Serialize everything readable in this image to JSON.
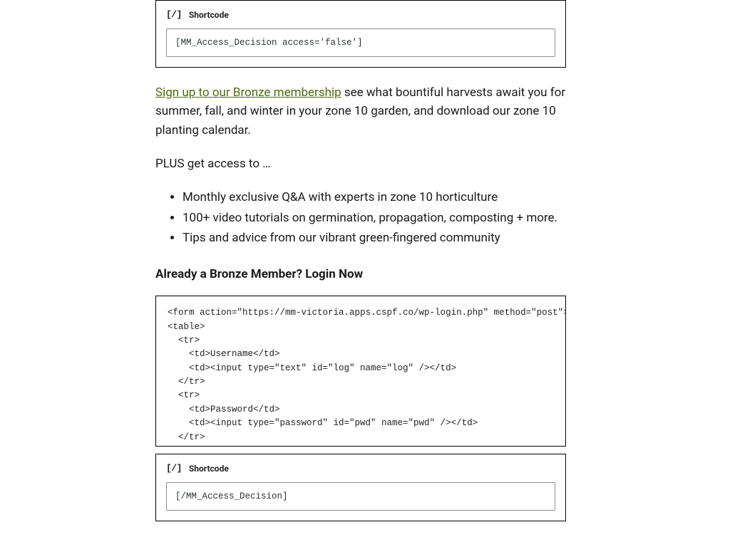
{
  "shortcode_block_1": {
    "icon_text": "[/]",
    "label": "Shortcode",
    "value": "[MM_Access_Decision access='false']"
  },
  "cta": {
    "link_text": "Sign up to our Bronze membership",
    "tail_text": " see what bountiful harvests await you for summer, fall, and winter in your zone 10 garden, and download our zone 10 planting calendar."
  },
  "access_intro": "PLUS get access to …",
  "bullets": [
    "Monthly exclusive Q&A with experts in zone 10 horticulture",
    "100+ video tutorials on germination, propagation, composting + more.",
    "Tips and advice from our vibrant green-fingered community"
  ],
  "login_heading": "Already a Bronze Member? Login Now",
  "code_snippet": "<form action=\"https://mm-victoria.apps.cspf.co/wp-login.php\" method=\"post\">\n<table>\n  <tr>\n    <td>Username</td>\n    <td><input type=\"text\" id=\"log\" name=\"log\" /></td>\n  </tr>\n  <tr>\n    <td>Password</td>\n    <td><input type=\"password\" id=\"pwd\" name=\"pwd\" /></td>\n  </tr>\n  <tr>",
  "shortcode_block_2": {
    "icon_text": "[/]",
    "label": "Shortcode",
    "value": "[/MM_Access_Decision]"
  }
}
